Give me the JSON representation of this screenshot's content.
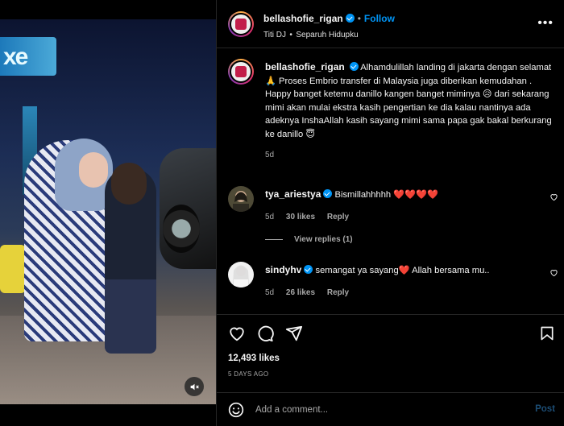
{
  "post": {
    "username": "bellashofie_rigan",
    "follow_label": "Follow",
    "music": "Titi DJ",
    "music_sep": "•",
    "song": "Separuh Hidupku",
    "more_glyph": "•••",
    "caption": {
      "username": "bellashofie_rigan",
      "line1": "Alhamdulillah landing di jakarta dengan selamat🙏 Proses Embrio transfer di Malaysia juga diberikan kemudahan .",
      "line2": "Happy banget ketemu danillo kangen banget miminya 😥 dari sekarang mimi akan mulai ekstra kasih pengertian ke dia kalau nantinya ada adeknya InshaAllah kasih sayang mimi sama papa gak bakal berkurang ke danillo 😇",
      "time": "5d"
    },
    "comments": [
      {
        "username": "tya_ariestya",
        "text": "Bismillahhhhh ❤️❤️❤️❤️",
        "time": "5d",
        "likes": "30 likes",
        "reply": "Reply"
      },
      {
        "username": "sindyhv",
        "text": "semangat ya sayang❤️ Allah bersama mu..",
        "time": "5d",
        "likes": "26 likes",
        "reply": "Reply"
      }
    ],
    "view_replies": "View replies (1)",
    "likes_count": "12,493 likes",
    "time_ago": "5 DAYS AGO",
    "add_comment_placeholder": "Add a comment...",
    "post_label": "Post"
  },
  "colors": {
    "accent": "#0095f6",
    "background": "#000000",
    "muted": "#a8a8a8",
    "heart": "#ed4956"
  },
  "icons": [
    "mute-icon",
    "heart-icon",
    "comment-icon",
    "share-icon",
    "bookmark-icon",
    "emoji-icon",
    "verified-icon",
    "more-icon"
  ]
}
